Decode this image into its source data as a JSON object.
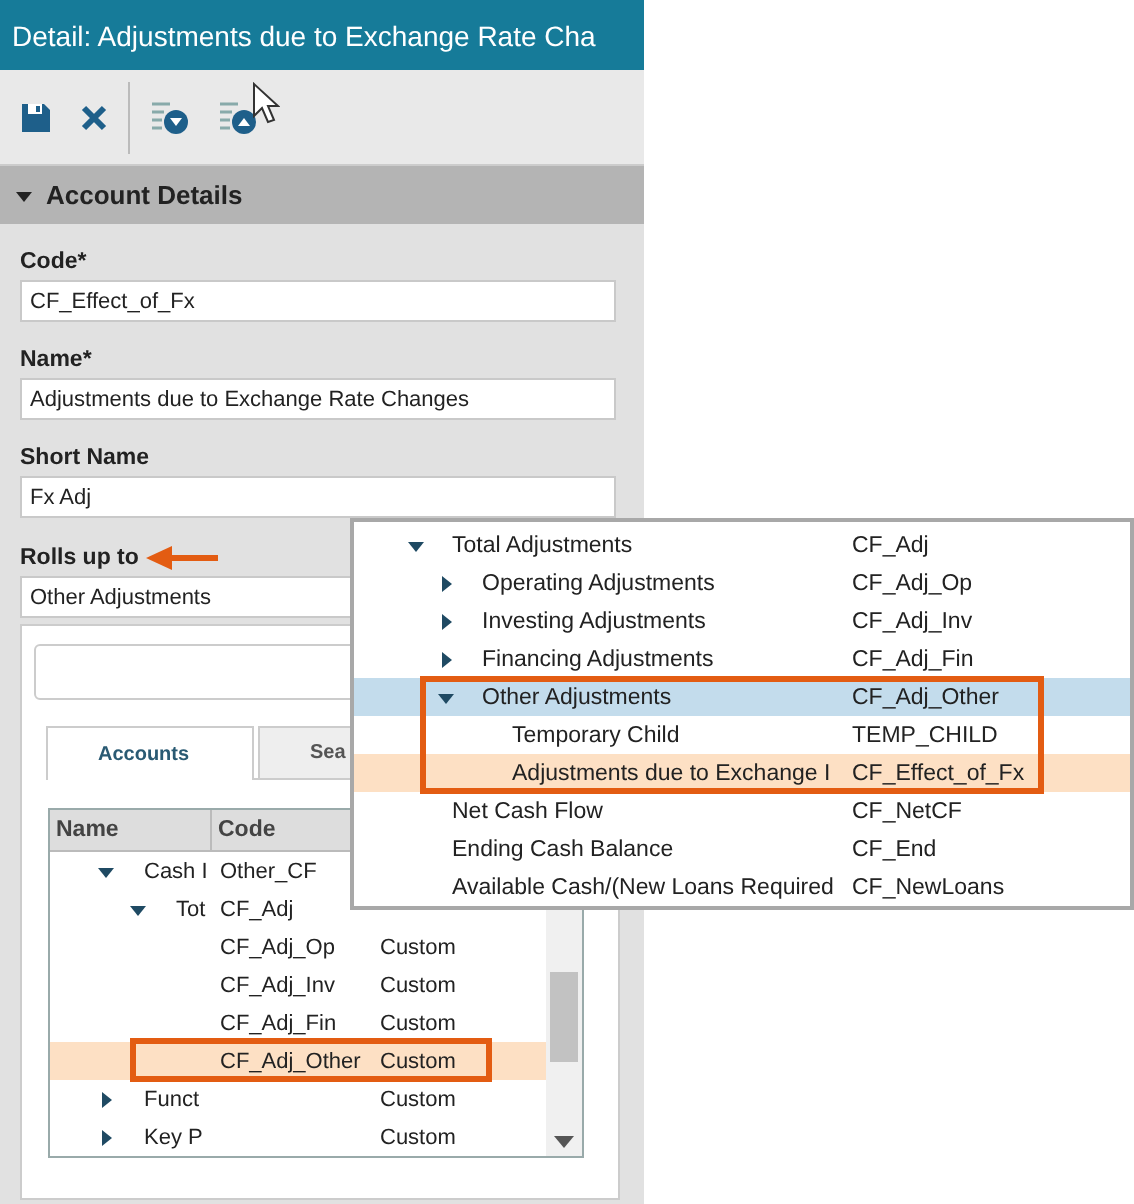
{
  "window": {
    "title": "Detail: Adjustments due to Exchange Rate Cha"
  },
  "toolbar": {
    "buttons": [
      {
        "kind": "save"
      },
      {
        "kind": "close"
      },
      {
        "kind": "expand"
      },
      {
        "kind": "collapse"
      }
    ]
  },
  "section": {
    "title": "Account Details",
    "expanded": true
  },
  "fields": [
    {
      "label": "Code*",
      "value": "CF_Effect_of_Fx"
    },
    {
      "label": "Name*",
      "value": "Adjustments due to Exchange Rate Changes"
    },
    {
      "label": "Short Name",
      "value": "Fx Adj"
    }
  ],
  "rolls_up_to": {
    "label": "Rolls up to",
    "value": "Other Adjustments"
  },
  "picker": {
    "tabs": [
      {
        "label": "Accounts",
        "selected": true
      },
      {
        "label": "Sea",
        "selected": false
      }
    ],
    "columns": [
      "Name",
      "Code"
    ],
    "rows": [
      {
        "name": "Cash I",
        "code": "Other_CF",
        "expanded": true,
        "current": false,
        "outlined": false,
        "children": [
          {
            "name": "Tot",
            "code": "CF_Adj",
            "expanded": true,
            "current": false,
            "outlined": false,
            "children": [
              {
                "code": "CF_Adj_Op",
                "column_3": "Custom",
                "current": false,
                "outlined": false
              },
              {
                "code": "CF_Adj_Inv",
                "column_3": "Custom",
                "current": false,
                "outlined": false
              },
              {
                "code": "CF_Adj_Fin",
                "column_3": "Custom",
                "current": false,
                "outlined": false
              },
              {
                "code": "CF_Adj_Other",
                "column_3": "Custom",
                "current": true,
                "outlined": true
              }
            ]
          }
        ]
      },
      {
        "name": "Funct",
        "column_3": "Custom",
        "expanded": false,
        "current": false,
        "outlined": false
      },
      {
        "name": "Key P",
        "column_3": "Custom",
        "expanded": false,
        "current": false,
        "outlined": false
      }
    ]
  },
  "callout": {
    "rows": [
      {
        "name": "Total Adjustments",
        "code": "CF_Adj",
        "expanded": true,
        "selected": false,
        "current": false,
        "outlined": false,
        "children": [
          {
            "name": "Operating Adjustments",
            "code": "CF_Adj_Op",
            "expanded": false,
            "selected": false,
            "current": false,
            "outlined": false
          },
          {
            "name": "Investing Adjustments",
            "code": "CF_Adj_Inv",
            "expanded": false,
            "selected": false,
            "current": false,
            "outlined": false
          },
          {
            "name": "Financing Adjustments",
            "code": "CF_Adj_Fin",
            "expanded": false,
            "selected": false,
            "current": false,
            "outlined": false
          },
          {
            "name": "Other Adjustments",
            "code": "CF_Adj_Other",
            "expanded": true,
            "selected": true,
            "current": false,
            "outlined": true,
            "children": [
              {
                "name": "Temporary Child",
                "code": "TEMP_CHILD",
                "selected": false,
                "current": false,
                "outlined": false
              },
              {
                "name": "Adjustments due to Exchange I",
                "code": "CF_Effect_of_Fx",
                "selected": false,
                "current": true,
                "outlined": false
              }
            ]
          }
        ]
      },
      {
        "name": "Net Cash Flow",
        "code": "CF_NetCF",
        "selected": false,
        "current": false,
        "outlined": false
      },
      {
        "name": "Ending Cash Balance",
        "code": "CF_End",
        "selected": false,
        "current": false,
        "outlined": false
      },
      {
        "name": "Available Cash/(New Loans Required",
        "code": "CF_NewLoans",
        "selected": false,
        "current": false,
        "outlined": false
      }
    ]
  }
}
